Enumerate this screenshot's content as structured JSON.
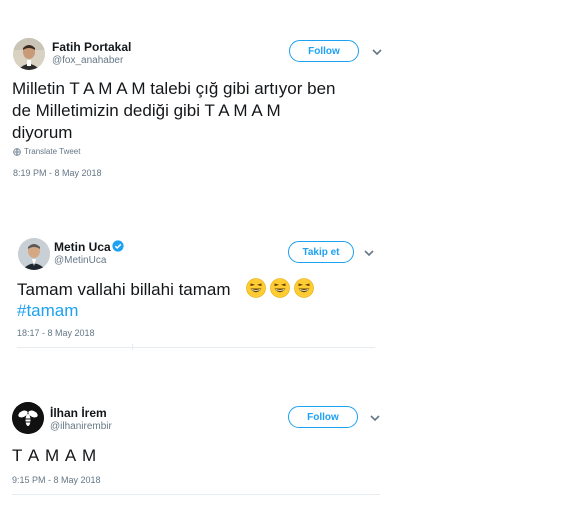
{
  "tweets": [
    {
      "name": "Fatih Portakal",
      "handle": "@fox_anahaber",
      "follow_label": "Follow",
      "text_lines": [
        "Milletin T A M A M talebi çığ gibi artıyor ben",
        "de Milletimizin dediği gibi T A M A M",
        "diyorum"
      ],
      "translate_label": "Translate Tweet",
      "timestamp": "8:19 PM - 8 May 2018"
    },
    {
      "name": "Metin Uca",
      "handle": "@MetinUca",
      "verified": true,
      "follow_label": "Takip et",
      "text": "Tamam vallahi billahi tamam",
      "emoji": [
        "grinning-squinting-face",
        "grinning-squinting-face",
        "grinning-squinting-face"
      ],
      "hashtag": "#tamam",
      "timestamp": "18:17 - 8 May 2018"
    },
    {
      "name": "İlhan İrem",
      "handle": "@ilhanirembir",
      "follow_label": "Follow",
      "text": "T A M A M",
      "timestamp": "9:15 PM - 8 May 2018"
    }
  ],
  "colors": {
    "accent": "#1da1f2",
    "text": "#14171a",
    "secondary": "#657786",
    "verified": "#1da1f2"
  },
  "icons": [
    "chevron-down-icon",
    "globe-icon",
    "verified-badge-icon",
    "emoji-icon"
  ]
}
